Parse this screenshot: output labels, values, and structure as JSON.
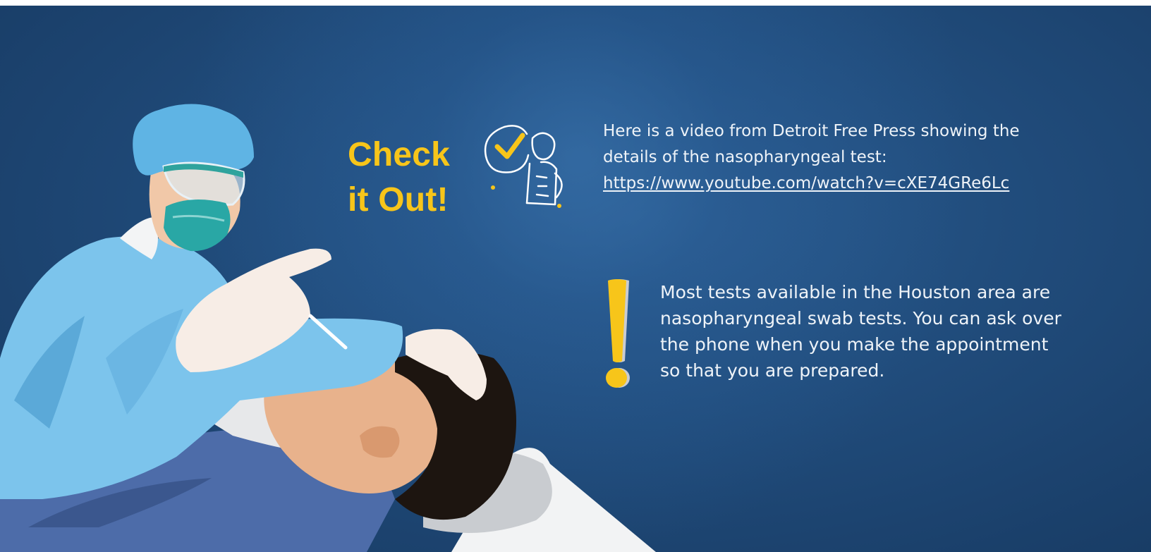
{
  "check_out": {
    "line1": "Check",
    "line2": "it Out!"
  },
  "video_note": {
    "line1": "Here is a video from Detroit Free Press showing the",
    "line2": "details of the nasopharyngeal test:",
    "link": "https://www.youtube.com/watch?v=cXE74GRe6Lc"
  },
  "tip": {
    "line1": "Most tests available in the Houston area are",
    "line2": "nasopharyngeal swab tests. You can ask over",
    "line3": "the phone when you make the appointment",
    "line4": "so that you are prepared."
  },
  "colors": {
    "background": "#1f4a78",
    "accent_yellow": "#f7c51a",
    "text": "#eef3f8"
  },
  "icons": {
    "doodle": "person-with-checkmark-icon",
    "exclamation": "exclamation-mark-icon"
  }
}
